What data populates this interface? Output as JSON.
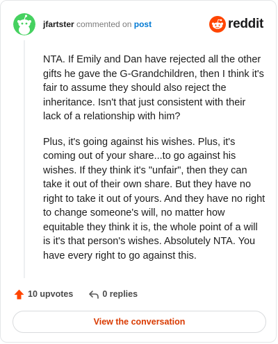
{
  "comment": {
    "username": "jfartster",
    "action": "commented on",
    "post_link": "post",
    "paragraphs": [
      "NTA. If Emily and Dan have rejected all the other gifts he gave the G-Grandchildren, then I think it's fair to assume they should also reject the inheritance. Isn't that just consistent with their lack of a relationship with him?",
      "Plus, it's going against his wishes. Plus, it's coming out of your share...to go against his wishes. If they think it's \"unfair\", then they can take it out of their own share. But they have no right to take it out of yours. And they have no right to change someone's will, no matter how equitable they think it is, the whole point of a will is it's that person's wishes. Absolutely NTA. You have every right to go against this."
    ]
  },
  "brand": {
    "name": "reddit",
    "color": "#ff4500",
    "icon": "reddit-snoo-icon"
  },
  "avatar": {
    "color": "#46d160",
    "icon": "snoo-avatar-icon"
  },
  "footer": {
    "upvotes_label": "10 upvotes",
    "replies_label": "0 replies",
    "upvote_icon": "upvote-arrow-icon",
    "reply_icon": "reply-arrow-icon",
    "upvote_color": "#ff4500"
  },
  "cta": {
    "label": "View the conversation",
    "color": "#d93a00"
  }
}
